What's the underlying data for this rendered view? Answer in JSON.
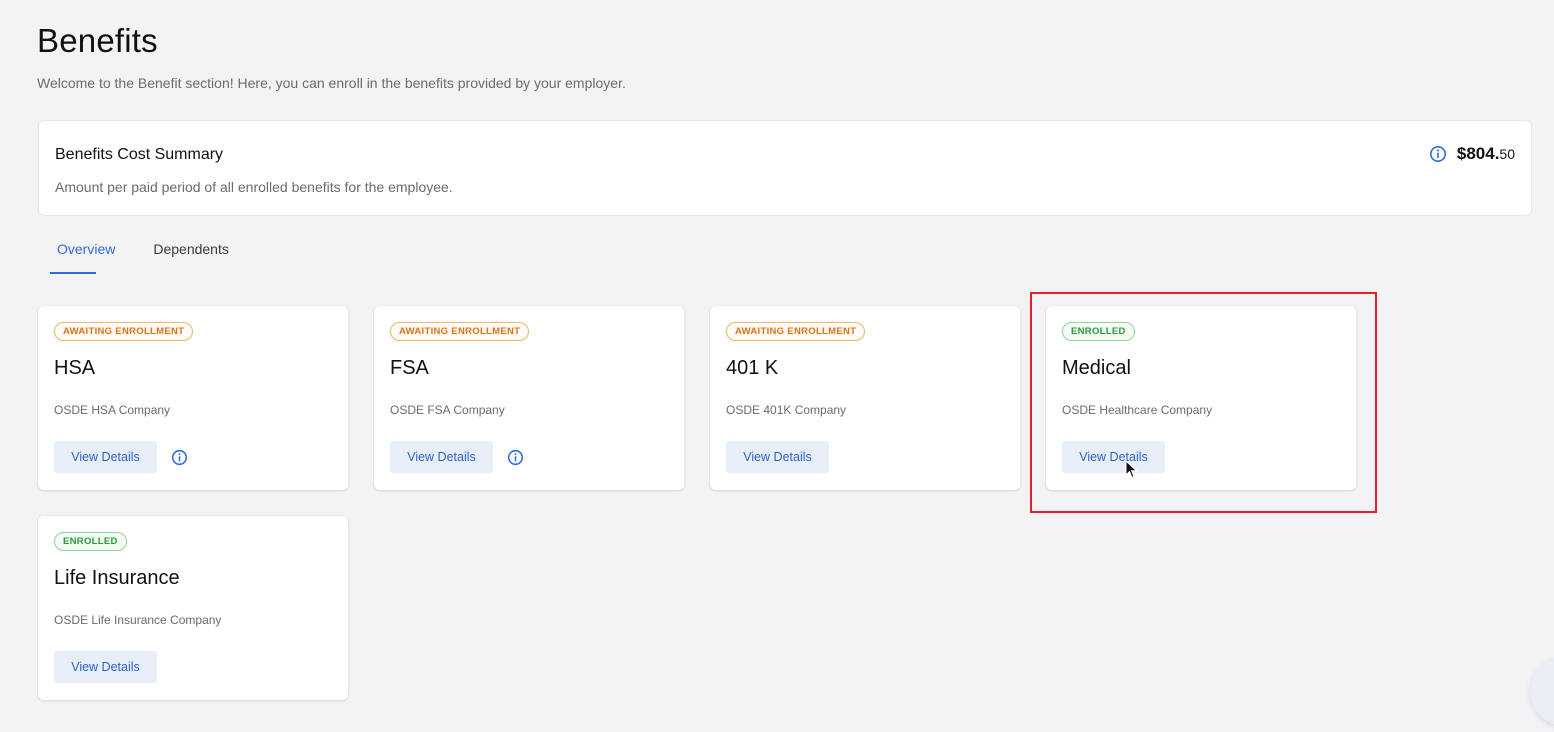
{
  "page": {
    "title": "Benefits",
    "subtitle": "Welcome to the Benefit section! Here, you can enroll in the benefits provided by your employer."
  },
  "summary": {
    "title": "Benefits Cost Summary",
    "description": "Amount per paid period of all enrolled benefits for the employee.",
    "amount_main": "$804.",
    "amount_cents": "50",
    "info_icon": "info-circle-icon"
  },
  "tabs": [
    {
      "label": "Overview",
      "active": true
    },
    {
      "label": "Dependents",
      "active": false
    }
  ],
  "colors": {
    "accent": "#2f6bd8",
    "awaiting": "#d9741a",
    "enrolled": "#2a9a3a",
    "highlight": "#e0202a"
  },
  "cards": [
    {
      "status": "AWAITING ENROLLMENT",
      "title": "HSA",
      "company": "OSDE HSA Company",
      "button": "View Details",
      "has_info": true
    },
    {
      "status": "AWAITING ENROLLMENT",
      "title": "FSA",
      "company": "OSDE FSA Company",
      "button": "View Details",
      "has_info": true
    },
    {
      "status": "AWAITING ENROLLMENT",
      "title": "401 K",
      "company": "OSDE 401K Company",
      "button": "View Details",
      "has_info": false
    },
    {
      "status": "ENROLLED",
      "title": "Medical",
      "company": "OSDE Healthcare Company",
      "button": "View Details",
      "has_info": false
    },
    {
      "status": "ENROLLED",
      "title": "Life Insurance",
      "company": "OSDE Life Insurance Company",
      "button": "View Details",
      "has_info": false
    }
  ]
}
